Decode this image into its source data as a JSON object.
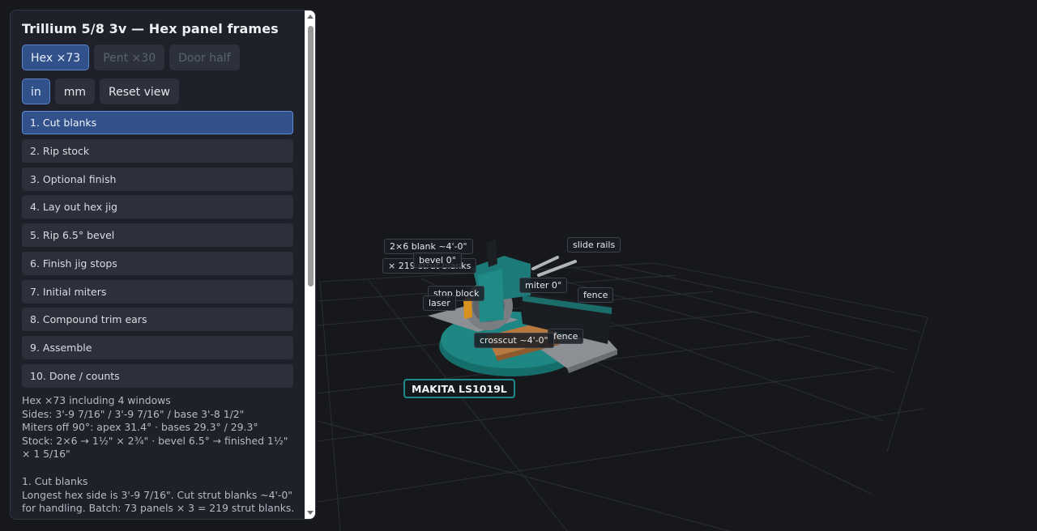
{
  "panel": {
    "title": "Trillium 5/8 3v — Hex panel frames",
    "panel_tabs": [
      {
        "label": "Hex ×73",
        "state": "active"
      },
      {
        "label": "Pent ×30",
        "state": "disabled"
      },
      {
        "label": "Door half",
        "state": "disabled"
      }
    ],
    "unit_buttons": [
      {
        "label": "in",
        "state": "active"
      },
      {
        "label": "mm",
        "state": "normal"
      }
    ],
    "reset_label": "Reset view",
    "steps": [
      "1. Cut blanks",
      "2. Rip stock",
      "3. Optional finish",
      "4. Lay out hex jig",
      "5. Rip 6.5° bevel",
      "6. Finish jig stops",
      "7. Initial miters",
      "8. Compound trim ears",
      "9. Assemble",
      "10. Done / counts"
    ],
    "active_step": 0,
    "info": {
      "line1": "Hex ×73 including 4 windows",
      "line2": "Sides: 3'-9 7/16\" / 3'-9 7/16\" / base 3'-8 1/2\"",
      "line3": "Miters off 90°: apex 31.4° · bases 29.3° / 29.3°",
      "line4": "Stock: 2×6 → 1½\" × 2¾\" · bevel 6.5° → finished 1½\" × 1 5/16\"",
      "step_title": "1. Cut blanks",
      "step_text": "Longest hex side is 3'-9 7/16\". Cut strut blanks ~4'-0\" for handling. Batch: 73 panels × 3 = 219 strut blanks."
    }
  },
  "scene": {
    "saw_name": "MAKITA LS1019L",
    "labels": {
      "blank": "2×6 blank ~4'-0\"",
      "count": "× 219 strut blanks",
      "bevel": "bevel 0°",
      "slide_rails": "slide rails",
      "miter": "miter 0°",
      "fence_right": "fence",
      "stop_block": "stop block",
      "laser": "laser",
      "fence_front": "fence",
      "crosscut": "crosscut ~4'-0\""
    },
    "colors": {
      "background": "#17181b",
      "saw_body": "#1c7b78",
      "table": "#8a8d91",
      "wood": "#b7793f",
      "accent": "#5d8ad6"
    }
  }
}
